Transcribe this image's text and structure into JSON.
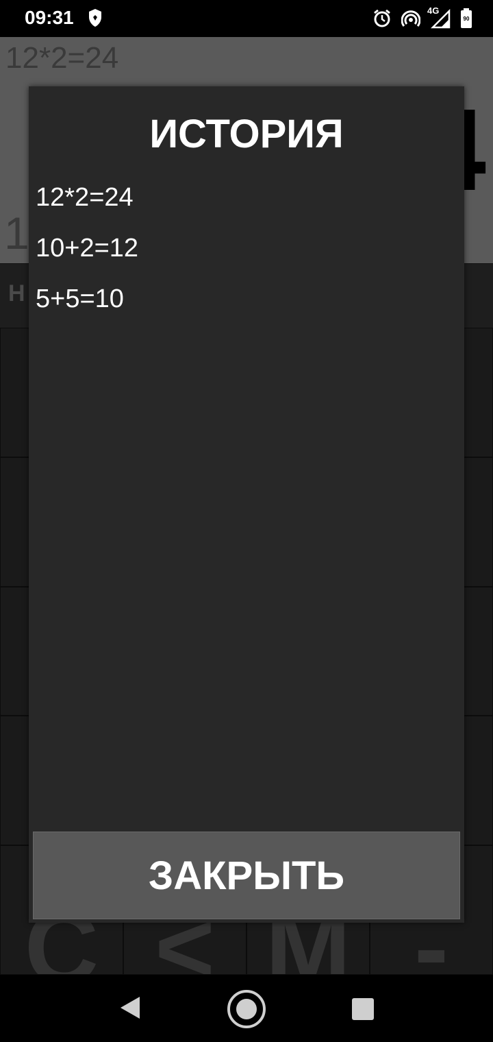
{
  "status_bar": {
    "time": "09:31",
    "network": "4G",
    "battery": "90",
    "icons": [
      "shield-icon",
      "alarm-icon",
      "hotspot-icon",
      "signal-icon",
      "battery-icon"
    ]
  },
  "calculator": {
    "previous": "12*2=24",
    "result": "4",
    "expression": "1",
    "memory_label": "H",
    "keys": [
      "",
      "",
      "",
      "",
      "",
      "",
      "",
      "",
      "",
      "",
      "",
      "",
      "",
      "",
      "",
      "",
      "C",
      "<",
      "M",
      "-"
    ]
  },
  "dialog": {
    "title": "ИСТОРИЯ",
    "history": [
      "12*2=24",
      "10+2=12",
      "5+5=10"
    ],
    "close_label": "ЗАКРЫТЬ"
  },
  "navigation": {
    "icons": [
      "back-icon",
      "home-icon",
      "recents-icon"
    ]
  },
  "colors": {
    "dialog_bg": "#282828",
    "button_bg": "#585858",
    "display_bg": "#5a5a5a"
  }
}
